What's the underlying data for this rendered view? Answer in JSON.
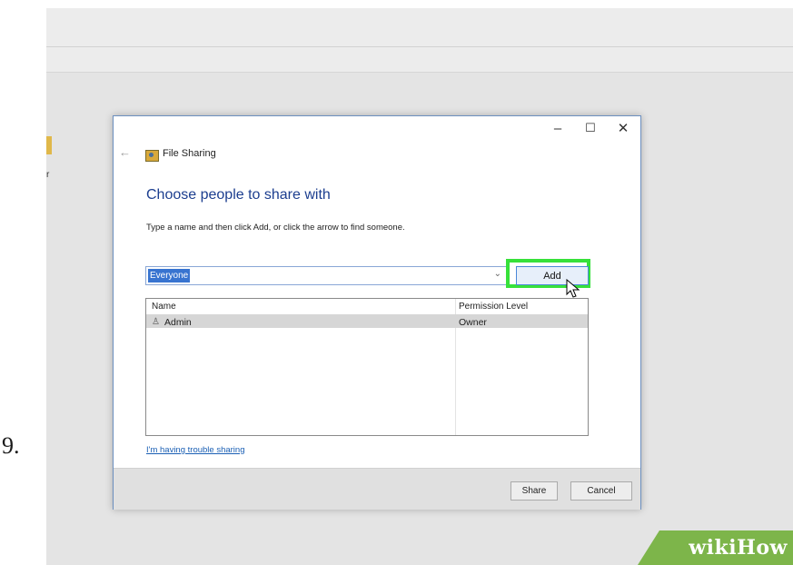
{
  "step_number": "9.",
  "dialog": {
    "title": "File Sharing",
    "heading": "Choose people to share with",
    "instructions": "Type a name and then click Add, or click the arrow to find someone.",
    "controls": {
      "minimize": "–",
      "maximize": "☐",
      "close": "✕"
    },
    "back_icon": "back-arrow-icon"
  },
  "name_input": {
    "value": "Everyone",
    "dropdown_icon": "chevron-down-icon"
  },
  "add_button": {
    "label": "Add",
    "highlight_color": "#37e13a"
  },
  "share_list": {
    "columns": [
      "Name",
      "Permission Level"
    ],
    "rows": [
      {
        "name": "Admin",
        "permission": "Owner",
        "icon": "user-icon"
      }
    ]
  },
  "trouble_link": "I'm having trouble sharing",
  "footer": {
    "share_label": "Share",
    "cancel_label": "Cancel"
  },
  "watermark": {
    "text": "wikiHow"
  },
  "colors": {
    "accent_link": "#1a5fb4",
    "heading": "#1c3e8f",
    "selection": "#3874d0"
  }
}
